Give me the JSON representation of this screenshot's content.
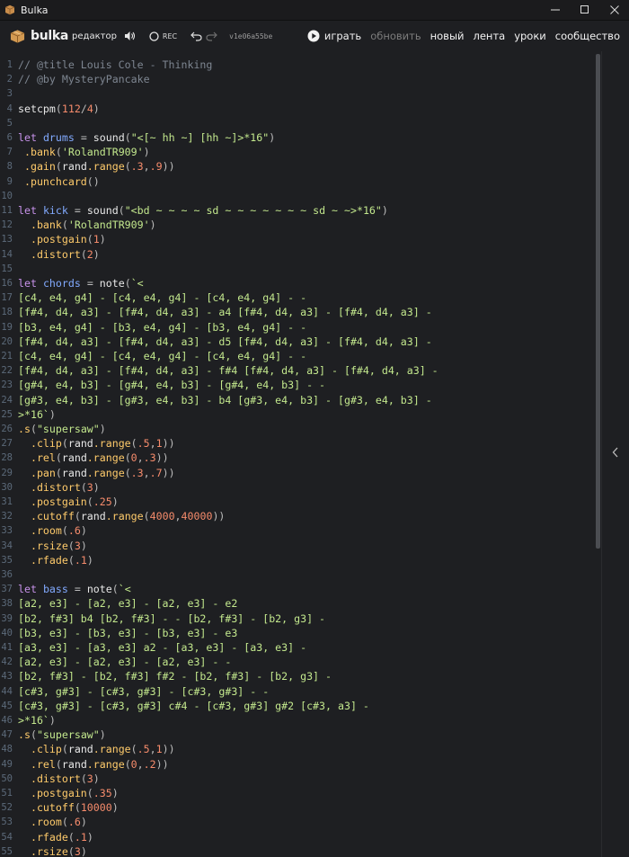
{
  "window": {
    "title": "Bulka"
  },
  "header": {
    "brand": "bulka",
    "brand_sub": "редактор",
    "rec_label": "REC",
    "version": "v1e06a55be",
    "nav": {
      "play": "играть",
      "update": "обновить",
      "new": "новый",
      "feed": "лента",
      "lessons": "уроки",
      "community": "сообщество"
    }
  },
  "colors": {
    "background": "#1e1f22",
    "comment": "#7e8691",
    "keyword": "#c792ea",
    "variable": "#82aaff",
    "function": "#e8e8e8",
    "method": "#ffcb6b",
    "string": "#c3e88d",
    "number": "#f78c6c",
    "line_number": "#5c6a7a"
  },
  "editor": {
    "lines": [
      {
        "n": "1",
        "text": "// @title Louis Cole - Thinking"
      },
      {
        "n": "2",
        "text": "// @by MysteryPancake"
      },
      {
        "n": "3",
        "text": ""
      },
      {
        "n": "4",
        "text": "setcpm(112/4)"
      },
      {
        "n": "5",
        "text": ""
      },
      {
        "n": "6",
        "text": "let drums = sound(\"<[~ hh ~] [hh ~]>*16\")"
      },
      {
        "n": "7",
        "text": " .bank('RolandTR909')"
      },
      {
        "n": "8",
        "text": " .gain(rand.range(.3,.9))"
      },
      {
        "n": "9",
        "text": " .punchcard()"
      },
      {
        "n": "10",
        "text": ""
      },
      {
        "n": "11",
        "text": "let kick = sound(\"<bd ~ ~ ~ ~ sd ~ ~ ~ ~ ~ ~ ~ sd ~ ~>*16\")"
      },
      {
        "n": "12",
        "text": "  .bank('RolandTR909')"
      },
      {
        "n": "13",
        "text": "  .postgain(1)"
      },
      {
        "n": "14",
        "text": "  .distort(2)"
      },
      {
        "n": "15",
        "text": ""
      },
      {
        "n": "16",
        "text": "let chords = note(`<"
      },
      {
        "n": "17",
        "text": "[c4, e4, g4] - [c4, e4, g4] - [c4, e4, g4] - -"
      },
      {
        "n": "18",
        "text": "[f#4, d4, a3] - [f#4, d4, a3] - a4 [f#4, d4, a3] - [f#4, d4, a3] -"
      },
      {
        "n": "19",
        "text": "[b3, e4, g4] - [b3, e4, g4] - [b3, e4, g4] - -"
      },
      {
        "n": "20",
        "text": "[f#4, d4, a3] - [f#4, d4, a3] - d5 [f#4, d4, a3] - [f#4, d4, a3] -"
      },
      {
        "n": "21",
        "text": "[c4, e4, g4] - [c4, e4, g4] - [c4, e4, g4] - -"
      },
      {
        "n": "22",
        "text": "[f#4, d4, a3] - [f#4, d4, a3] - f#4 [f#4, d4, a3] - [f#4, d4, a3] -"
      },
      {
        "n": "23",
        "text": "[g#4, e4, b3] - [g#4, e4, b3] - [g#4, e4, b3] - -"
      },
      {
        "n": "24",
        "text": "[g#3, e4, b3] - [g#3, e4, b3] - b4 [g#3, e4, b3] - [g#3, e4, b3] -"
      },
      {
        "n": "25",
        "text": ">*16`)"
      },
      {
        "n": "26",
        "text": ".s(\"supersaw\")"
      },
      {
        "n": "27",
        "text": "  .clip(rand.range(.5,1))"
      },
      {
        "n": "28",
        "text": "  .rel(rand.range(0,.3))"
      },
      {
        "n": "29",
        "text": "  .pan(rand.range(.3,.7))"
      },
      {
        "n": "30",
        "text": "  .distort(3)"
      },
      {
        "n": "31",
        "text": "  .postgain(.25)"
      },
      {
        "n": "32",
        "text": "  .cutoff(rand.range(4000,40000))"
      },
      {
        "n": "33",
        "text": "  .room(.6)"
      },
      {
        "n": "34",
        "text": "  .rsize(3)"
      },
      {
        "n": "35",
        "text": "  .rfade(.1)"
      },
      {
        "n": "36",
        "text": ""
      },
      {
        "n": "37",
        "text": "let bass = note(`<"
      },
      {
        "n": "38",
        "text": "[a2, e3] - [a2, e3] - [a2, e3] - e2"
      },
      {
        "n": "39",
        "text": "[b2, f#3] b4 [b2, f#3] - - [b2, f#3] - [b2, g3] -"
      },
      {
        "n": "40",
        "text": "[b3, e3] - [b3, e3] - [b3, e3] - e3"
      },
      {
        "n": "41",
        "text": "[a3, e3] - [a3, e3] a2 - [a3, e3] - [a3, e3] -"
      },
      {
        "n": "42",
        "text": "[a2, e3] - [a2, e3] - [a2, e3] - -"
      },
      {
        "n": "43",
        "text": "[b2, f#3] - [b2, f#3] f#2 - [b2, f#3] - [b2, g3] -"
      },
      {
        "n": "44",
        "text": "[c#3, g#3] - [c#3, g#3] - [c#3, g#3] - -"
      },
      {
        "n": "45",
        "text": "[c#3, g#3] - [c#3, g#3] c#4 - [c#3, g#3] g#2 [c#3, a3] -"
      },
      {
        "n": "46",
        "text": ">*16`)"
      },
      {
        "n": "47",
        "text": ".s(\"supersaw\")"
      },
      {
        "n": "48",
        "text": "  .clip(rand.range(.5,1))"
      },
      {
        "n": "49",
        "text": "  .rel(rand.range(0,.2))"
      },
      {
        "n": "50",
        "text": "  .distort(3)"
      },
      {
        "n": "51",
        "text": "  .postgain(.35)"
      },
      {
        "n": "52",
        "text": "  .cutoff(10000)"
      },
      {
        "n": "53",
        "text": "  .room(.6)"
      },
      {
        "n": "54",
        "text": "  .rfade(.1)"
      },
      {
        "n": "55",
        "text": "  .rsize(3)"
      }
    ]
  }
}
